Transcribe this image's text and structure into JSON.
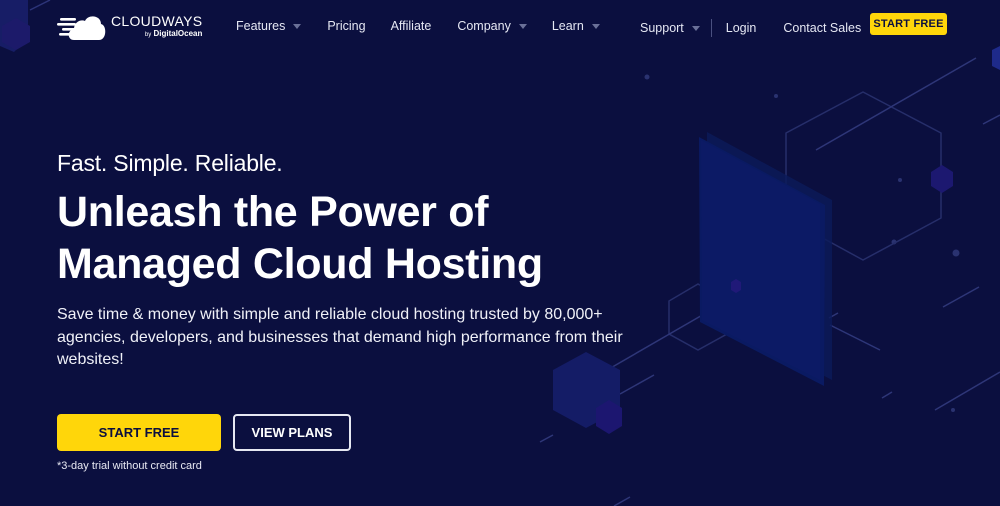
{
  "brand": {
    "name": "CLOUDWAYS",
    "sub_by": "by",
    "sub_name": "DigitalOcean",
    "accent_color": "#ffd60a",
    "background_color": "#0b0f3f"
  },
  "nav": {
    "items": [
      {
        "label": "Features",
        "has_dropdown": true
      },
      {
        "label": "Pricing",
        "has_dropdown": false
      },
      {
        "label": "Affiliate",
        "has_dropdown": false
      },
      {
        "label": "Company",
        "has_dropdown": true
      },
      {
        "label": "Learn",
        "has_dropdown": true
      }
    ],
    "right": {
      "support": "Support",
      "login": "Login",
      "contact": "Contact Sales",
      "cta": "START FREE"
    }
  },
  "hero": {
    "tagline": "Fast. Simple. Reliable.",
    "headline_line1": "Unleash the Power of",
    "headline_line2": "Managed Cloud Hosting",
    "description": "Save time & money with simple and reliable cloud hosting trusted by 80,000+ agencies, developers, and businesses that demand high performance from their websites!",
    "primary_cta": "START FREE",
    "secondary_cta": "VIEW PLANS",
    "note": "*3-day trial without credit card"
  }
}
